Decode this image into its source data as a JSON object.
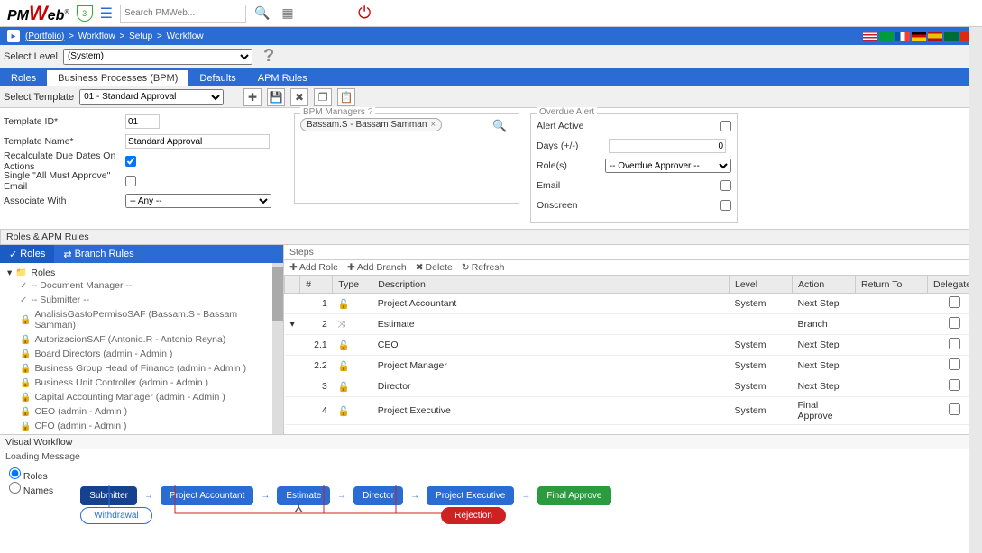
{
  "header": {
    "logo_pm": "PM",
    "logo_web": "Web",
    "shield": "3",
    "search_placeholder": "Search PMWeb..."
  },
  "breadcrumb": {
    "parts": [
      "(Portfolio)",
      "Workflow",
      "Setup",
      "Workflow"
    ]
  },
  "level": {
    "label": "Select Level",
    "value": "(System)"
  },
  "tabs": {
    "roles": "Roles",
    "bpm": "Business Processes (BPM)",
    "defaults": "Defaults",
    "apm": "APM Rules"
  },
  "toolbar": {
    "select_template": "Select Template",
    "template_value": "01 - Standard Approval"
  },
  "form": {
    "template_id_label": "Template ID*",
    "template_id": "01",
    "template_name_label": "Template Name*",
    "template_name": "Standard Approval",
    "recalc_label": "Recalculate Due Dates On Actions",
    "single_label": "Single \"All Must Approve\" Email",
    "associate_label": "Associate With",
    "associate_value": "-- Any --"
  },
  "managers": {
    "legend": "BPM Managers",
    "tag": "Bassam.S - Bassam Samman"
  },
  "overdue": {
    "legend": "Overdue Alert",
    "active": "Alert Active",
    "days": "Days (+/-)",
    "days_val": "0",
    "roles": "Role(s)",
    "roles_val": "-- Overdue Approver --",
    "email": "Email",
    "onscreen": "Onscreen"
  },
  "rules_hdr": "Roles & APM Rules",
  "subtabs": {
    "roles": "Roles",
    "branch": "Branch Rules"
  },
  "tree": {
    "root": "Roles",
    "items": [
      "-- Document Manager --",
      "-- Submitter --",
      "AnalisisGastoPermisoSAF (Bassam.S - Bassam Samman)",
      "AutorizacionSAF (Antonio.R - Antonio Reyna)",
      "Board Directors (admin - Admin )",
      "Business Group Head of Finance (admin - Admin )",
      "Business Unit Controller (admin - Admin )",
      "Capital Accounting Manager (admin - Admin )",
      "CEO (admin - Admin )",
      "CFO (admin - Admin )"
    ]
  },
  "steps": {
    "hdr": "Steps",
    "add_role": "Add Role",
    "add_branch": "Add Branch",
    "delete": "Delete",
    "refresh": "Refresh",
    "cols": {
      "num": "#",
      "type": "Type",
      "desc": "Description",
      "level": "Level",
      "action": "Action",
      "return": "Return To",
      "delegate": "Delegate"
    },
    "rows": [
      {
        "n": "1",
        "desc": "Project Accountant",
        "level": "System",
        "action": "Next Step"
      },
      {
        "n": "2",
        "desc": "Estimate",
        "level": "",
        "action": "Branch",
        "branch": true
      },
      {
        "n": "2.1",
        "desc": "CEO",
        "level": "System",
        "action": "Next Step",
        "sub": true
      },
      {
        "n": "2.2",
        "desc": "Project Manager",
        "level": "System",
        "action": "Next Step",
        "sub": true
      },
      {
        "n": "3",
        "desc": "Director",
        "level": "System",
        "action": "Next Step"
      },
      {
        "n": "4",
        "desc": "Project Executive",
        "level": "System",
        "action": "Final Approve"
      }
    ]
  },
  "visual": {
    "hdr": "Visual Workflow",
    "loading": "Loading Message",
    "radio_roles": "Roles",
    "radio_names": "Names",
    "nodes": {
      "submitter": "Submitter",
      "pa": "Project Accountant",
      "est": "Estimate",
      "dir": "Director",
      "pe": "Project Executive",
      "fa": "Final Approve"
    },
    "withdrawal": "Withdrawal",
    "rejection": "Rejection"
  }
}
